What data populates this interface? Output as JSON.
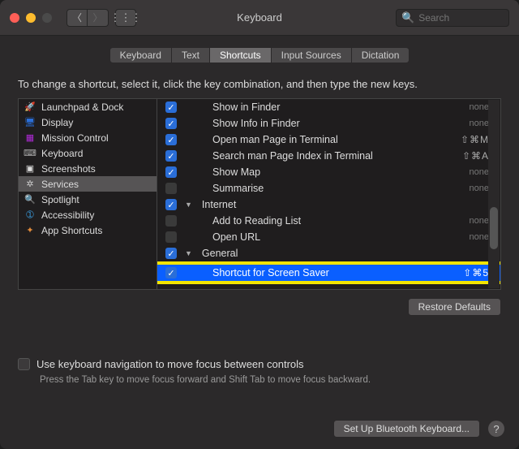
{
  "title": "Keyboard",
  "search": {
    "placeholder": "Search"
  },
  "tabs": [
    {
      "label": "Keyboard",
      "active": false
    },
    {
      "label": "Text",
      "active": false
    },
    {
      "label": "Shortcuts",
      "active": true
    },
    {
      "label": "Input Sources",
      "active": false
    },
    {
      "label": "Dictation",
      "active": false
    }
  ],
  "instruction": "To change a shortcut, select it, click the key combination, and then type the new keys.",
  "categories": [
    {
      "icon": "launchpad-icon",
      "glyph": "🚀",
      "color": "#444",
      "label": "Launchpad & Dock",
      "selected": false
    },
    {
      "icon": "display-icon",
      "glyph": "🖥",
      "color": "#2a6ed8",
      "label": "Display",
      "selected": false
    },
    {
      "icon": "mission-control-icon",
      "glyph": "▦",
      "color": "#b02ad8",
      "label": "Mission Control",
      "selected": false
    },
    {
      "icon": "keyboard-icon",
      "glyph": "⌨",
      "color": "#aaa",
      "label": "Keyboard",
      "selected": false
    },
    {
      "icon": "screenshots-icon",
      "glyph": "▣",
      "color": "#ddd",
      "label": "Screenshots",
      "selected": false
    },
    {
      "icon": "services-icon",
      "glyph": "✲",
      "color": "#ccc",
      "label": "Services",
      "selected": true
    },
    {
      "icon": "spotlight-icon",
      "glyph": "🔍",
      "color": "#ccc",
      "label": "Spotlight",
      "selected": false
    },
    {
      "icon": "accessibility-icon",
      "glyph": "➀",
      "color": "#3a9de0",
      "label": "Accessibility",
      "selected": false
    },
    {
      "icon": "app-shortcuts-icon",
      "glyph": "✦",
      "color": "#e08a3a",
      "label": "App Shortcuts",
      "selected": false
    }
  ],
  "shortcuts": [
    {
      "type": "item",
      "checked": true,
      "label": "Show in Finder",
      "shortcut": "none",
      "none": true
    },
    {
      "type": "item",
      "checked": true,
      "label": "Show Info in Finder",
      "shortcut": "none",
      "none": true
    },
    {
      "type": "item",
      "checked": true,
      "label": "Open man Page in Terminal",
      "shortcut": "⇧⌘M",
      "none": false
    },
    {
      "type": "item",
      "checked": true,
      "label": "Search man Page Index in Terminal",
      "shortcut": "⇧⌘A",
      "none": false
    },
    {
      "type": "item",
      "checked": true,
      "label": "Show Map",
      "shortcut": "none",
      "none": true
    },
    {
      "type": "item",
      "checked": false,
      "label": "Summarise",
      "shortcut": "none",
      "none": true
    },
    {
      "type": "group",
      "checked": true,
      "label": "Internet"
    },
    {
      "type": "item",
      "checked": false,
      "label": "Add to Reading List",
      "shortcut": "none",
      "none": true
    },
    {
      "type": "item",
      "checked": false,
      "label": "Open URL",
      "shortcut": "none",
      "none": true
    },
    {
      "type": "group",
      "checked": true,
      "label": "General"
    },
    {
      "type": "highlight",
      "checked": true,
      "label": "Shortcut for Screen Saver",
      "shortcut": "⇧⌘5",
      "none": false
    }
  ],
  "restore_label": "Restore Defaults",
  "kbnav": {
    "label": "Use keyboard navigation to move focus between controls",
    "hint": "Press the Tab key to move focus forward and Shift Tab to move focus backward."
  },
  "footer": {
    "bluetooth": "Set Up Bluetooth Keyboard...",
    "help": "?"
  }
}
